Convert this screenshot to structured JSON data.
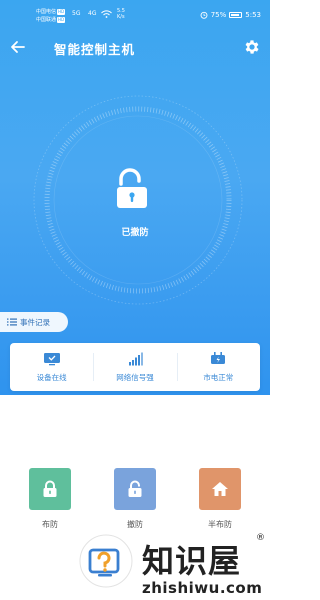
{
  "status_bar": {
    "carrier1": "中国电信",
    "carrier1_badge": "HD",
    "carrier2": "中国联通",
    "carrier2_badge": "HD",
    "signal1": "5G",
    "signal2": "4G",
    "speed": "5.5 K/s",
    "battery": "75%",
    "time": "5:53"
  },
  "header": {
    "title": "智能控制主机",
    "back_icon": "arrow-left-icon",
    "settings_icon": "gear-icon"
  },
  "main": {
    "lock_icon": "unlock-icon",
    "status": "已撤防"
  },
  "event_log": {
    "label": "事件记录",
    "icon": "list-icon"
  },
  "status_card": {
    "items": [
      {
        "icon": "monitor-icon",
        "label": "设备在线"
      },
      {
        "icon": "signal-bars-icon",
        "label": "网络信号强"
      },
      {
        "icon": "power-plug-icon",
        "label": "市电正常"
      }
    ]
  },
  "actions": [
    {
      "label": "布防",
      "icon": "lock-icon",
      "color": "#5fbf9c"
    },
    {
      "label": "撤防",
      "icon": "unlock-icon",
      "color": "#7aa3dc"
    },
    {
      "label": "半布防",
      "icon": "home-icon",
      "color": "#e0956a"
    }
  ],
  "watermark": {
    "text": "知识屋",
    "url": "zhishiwu.com",
    "reg": "®"
  },
  "colors": {
    "primary": "#3ba6f0",
    "card_text": "#3a89d6",
    "arm": "#5fbf9c",
    "disarm": "#7aa3dc",
    "half_arm": "#e0956a"
  }
}
